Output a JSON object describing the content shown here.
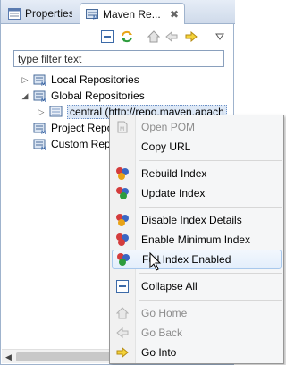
{
  "tabs": [
    {
      "label": "Properties",
      "icon": "properties-icon",
      "active": false
    },
    {
      "label": "Maven Re...",
      "icon": "maven-repo-icon",
      "active": true,
      "close": "✖"
    }
  ],
  "toolbar": {
    "icons": [
      "collapse-all-icon",
      "refresh-icon",
      "home-icon",
      "back-arrow-icon",
      "forward-arrow-icon",
      "view-menu-icon"
    ]
  },
  "filter": {
    "placeholder": "type filter text",
    "value": ""
  },
  "tree": {
    "items": [
      {
        "label": "Local Repositories"
      },
      {
        "label": "Global Repositories"
      },
      {
        "label": "central (http://repo.maven.apach"
      },
      {
        "label": "Project Repo"
      },
      {
        "label": "Custom Rep"
      }
    ]
  },
  "context_menu": {
    "items": [
      {
        "label": "Open POM",
        "icon": "pom-file-icon",
        "enabled": false
      },
      {
        "label": "Copy URL",
        "icon": "",
        "enabled": true
      },
      {
        "label": "Rebuild Index",
        "icon": "rebuild-index-icon",
        "enabled": true
      },
      {
        "label": "Update Index",
        "icon": "update-index-icon",
        "enabled": true
      },
      {
        "label": "Disable Index Details",
        "icon": "disable-index-icon",
        "enabled": true
      },
      {
        "label": "Enable Minimum Index",
        "icon": "minimum-index-icon",
        "enabled": true
      },
      {
        "label": "Full Index Enabled",
        "icon": "full-index-icon",
        "enabled": true,
        "hovered": true
      },
      {
        "label": "Collapse All",
        "icon": "collapse-all-icon",
        "enabled": true
      },
      {
        "label": "Go Home",
        "icon": "home-icon",
        "enabled": false
      },
      {
        "label": "Go Back",
        "icon": "back-arrow-icon",
        "enabled": false
      },
      {
        "label": "Go Into",
        "icon": "forward-arrow-icon",
        "enabled": true
      }
    ]
  },
  "colors": {
    "accent": "#3b5fa0",
    "hover_border": "#a8c8ec",
    "disabled_text": "#8d8d8d"
  }
}
